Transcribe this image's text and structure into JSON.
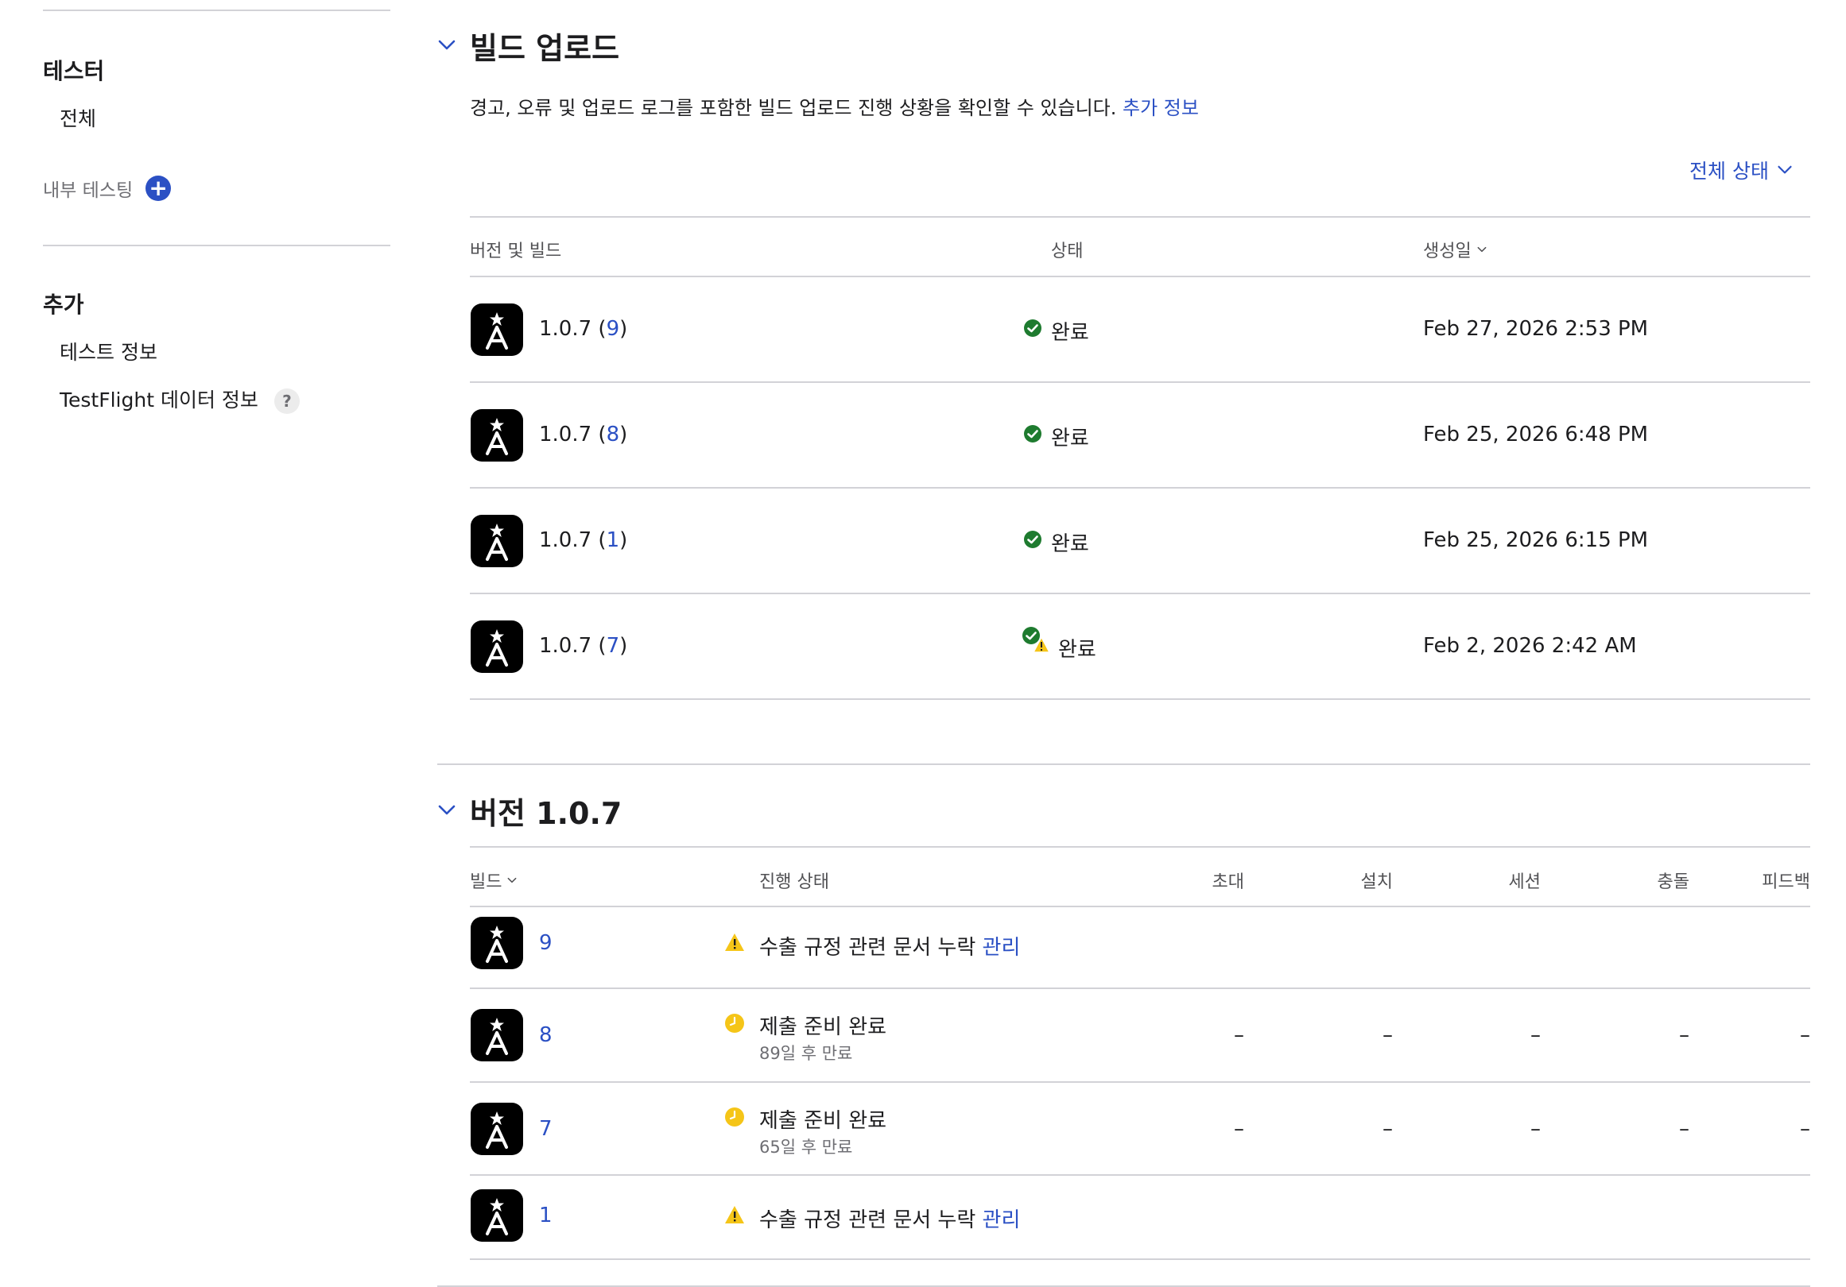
{
  "sidebar": {
    "testers_heading": "테스터",
    "all_item": "전체",
    "internal_testing": "내부 테스팅",
    "extra_heading": "추가",
    "test_info": "테스트 정보",
    "testflight_data": "TestFlight 데이터 정보",
    "help_glyph": "?"
  },
  "build_upload": {
    "title": "빌드 업로드",
    "description": "경고, 오류 및 업로드 로그를 포함한 빌드 업로드 진행 상황을 확인할 수 있습니다.",
    "more_info": "추가 정보",
    "filter_label": "전체 상태",
    "columns": {
      "version_build": "버전 및 빌드",
      "status": "상태",
      "created": "생성일"
    },
    "rows": [
      {
        "version": "1.0.7 (",
        "build": "9",
        "close": ")",
        "status": "완료",
        "date": "Feb 27, 2026 2:53 PM"
      },
      {
        "version": "1.0.7 (",
        "build": "8",
        "close": ")",
        "status": "완료",
        "date": "Feb 25, 2026 6:48 PM"
      },
      {
        "version": "1.0.7 (",
        "build": "1",
        "close": ")",
        "status": "완료",
        "date": "Feb 25, 2026 6:15 PM"
      },
      {
        "version": "1.0.7 (",
        "build": "7",
        "close": ")",
        "status": "완료",
        "date": "Feb 2, 2026 2:42 AM"
      }
    ]
  },
  "version_section": {
    "title": "버전 1.0.7",
    "columns": {
      "build": "빌드",
      "progress": "진행 상태",
      "invites": "초대",
      "installs": "설치",
      "sessions": "세션",
      "crashes": "충돌",
      "feedback": "피드백"
    },
    "rows": [
      {
        "build": "9",
        "status": "수출 규정 관련 문서 누락",
        "action": "관리"
      },
      {
        "build": "8",
        "status": "제출 준비 완료",
        "sub": "89일 후 만료",
        "dash": "–"
      },
      {
        "build": "7",
        "status": "제출 준비 완료",
        "sub": "65일 후 만료",
        "dash": "–"
      },
      {
        "build": "1",
        "status": "수출 규정 관련 문서 누락",
        "action": "관리"
      }
    ]
  },
  "colors": {
    "accent": "#2b50c4",
    "success": "#1e7b2f",
    "warning": "#f5c518",
    "rule": "#d2d2d7"
  }
}
